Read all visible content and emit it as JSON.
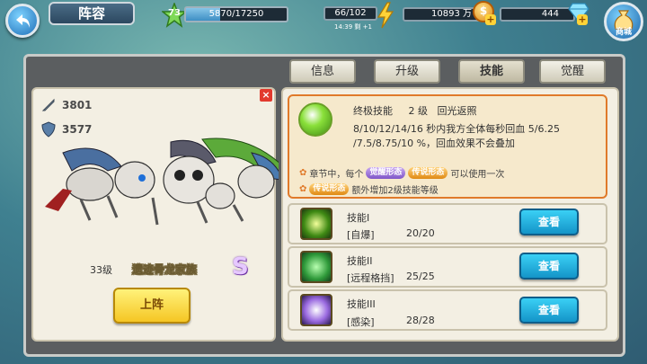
{
  "header": {
    "title": "阵容",
    "player_level": "73",
    "xp_text": "5870/17250",
    "xp_fraction": 0.34,
    "stamina": "66/102",
    "stamina_timer": "14:39 剩 +1",
    "gold": "10893 万",
    "gems": "444",
    "shop_label": "商城"
  },
  "tabs": [
    {
      "label": "信息",
      "active": false
    },
    {
      "label": "升级",
      "active": false
    },
    {
      "label": "技能",
      "active": true
    },
    {
      "label": "觉醒",
      "active": false
    }
  ],
  "hero": {
    "attack": "3801",
    "defense": "3577",
    "level": "33级",
    "name": "遗迹骨龙家族",
    "rank": "S",
    "deploy_label": "上阵"
  },
  "ultimate": {
    "label": "终极技能",
    "level": "2 级",
    "name": "回光返照",
    "desc": "8/10/12/14/16 秒内我方全体每秒回血 5/6.25 /7.5/8.75/10 %，回血效果不会叠加",
    "note1_prefix": "章节中，每个",
    "note1_badge1": "觉醒形态",
    "note1_badge2": "传说形态",
    "note1_suffix": "可以使用一次",
    "note2_badge": "传说形态",
    "note2_suffix": "额外增加2级技能等级"
  },
  "skills": [
    {
      "name": "技能I",
      "type": "[自爆]",
      "level": "20/20",
      "button": "查看"
    },
    {
      "name": "技能II",
      "type": "[远程格挡]",
      "level": "25/25",
      "button": "查看"
    },
    {
      "name": "技能III",
      "type": "[感染]",
      "level": "28/28",
      "button": "查看"
    }
  ],
  "colors": {
    "accent_orange": "#e07a2a",
    "button_blue": "#1494c8",
    "button_yellow": "#f5c624"
  }
}
